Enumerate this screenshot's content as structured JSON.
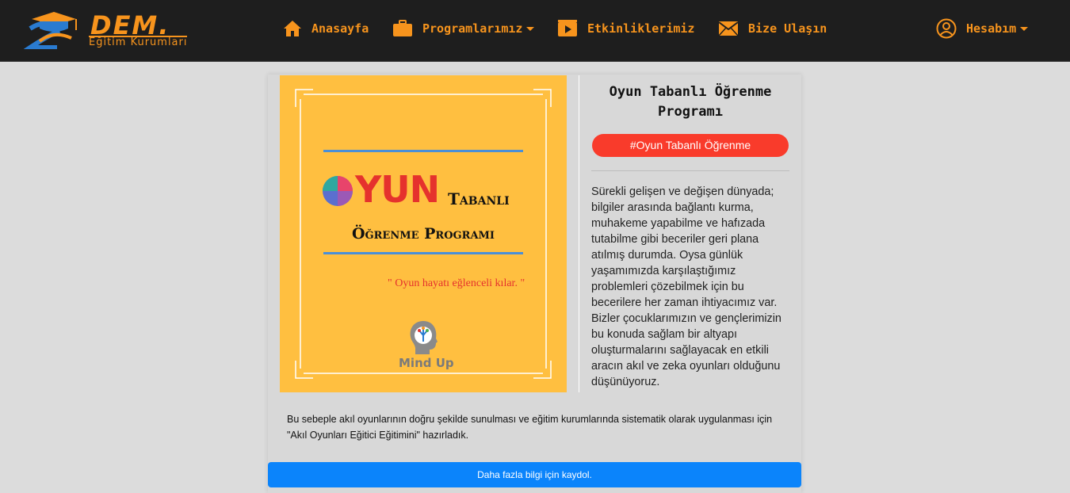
{
  "brand": {
    "name": "DEM.",
    "subtitle": "Eğitim Kurumları"
  },
  "nav": {
    "home": "Anasayfa",
    "programs": "Programlarımız",
    "events": "Etkinliklerimiz",
    "contact": "Bize Ulaşın",
    "account": "Hesabım"
  },
  "poster": {
    "word_big": "YUN",
    "word_small": "Tabanlı",
    "line2": "Öğrenme Programı",
    "motto": "\" Oyun hayatı eğlenceli kılar. \"",
    "logo_text": "Mind Up"
  },
  "program": {
    "title": "Oyun Tabanlı Öğrenme Programı",
    "tag": "#Oyun Tabanlı Öğrenme",
    "description": "Sürekli gelişen ve değişen dünyada; bilgiler arasında bağlantı kurma, muhakeme yapabilme ve hafızada tutabilme gibi beceriler geri plana atılmış durumda. Oysa günlük yaşamımızda karşılaştığımız problemleri çözebilmek için bu becerilere her zaman ihtiyacımız var. Bizler çocuklarımızın ve gençlerimizin bu konuda sağlam bir altyapı oluşturmalarını sağlayacak en etkili aracın akıl ve zeka oyunları olduğunu düşünüyoruz.",
    "extra": "Bu sebeple akıl oyunlarının doğru şekilde sunulması ve eğitim kurumlarında sistematik olarak uygulanması için \"Akıl Oyunları Eğitici Eğitimini\" hazırladık.",
    "cta": "Daha fazla bilgi için kaydol."
  },
  "colors": {
    "accent": "#f7941d",
    "navbar": "#1e1e1e",
    "poster_bg": "#ffbf40",
    "tag_bg": "#f93b2b",
    "cta_bg": "#0b84fb"
  },
  "icons": [
    "home-icon",
    "briefcase-icon",
    "video-icon",
    "envelope-icon",
    "user-circle-icon"
  ]
}
